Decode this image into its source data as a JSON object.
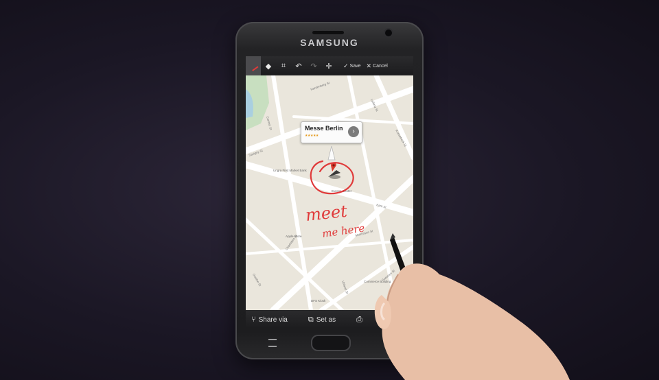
{
  "device": {
    "brand": "SAMSUNG"
  },
  "toolbar": {
    "tools": [
      {
        "name": "pen-icon",
        "active": true
      },
      {
        "name": "eraser-icon"
      },
      {
        "name": "crop-icon"
      },
      {
        "name": "undo-icon"
      },
      {
        "name": "redo-icon"
      },
      {
        "name": "move-icon"
      }
    ],
    "save_label": "Save",
    "cancel_label": "Cancel"
  },
  "map": {
    "callout_title": "Messe Berlin",
    "callout_rating": "★★★★★",
    "streets": [
      "Hardenberg St",
      "Leibniz St",
      "Carmer St",
      "Knesebeck St",
      "Savigny St",
      "Kant St",
      "Charlotten St",
      "Uhland St",
      "Fasanen St",
      "Goethe St",
      "Mommsen St"
    ],
    "places": [
      "Ungra First Market Bank",
      "Europa Center",
      "Apple Store",
      "Commerce Building",
      "DFS Kiosk"
    ],
    "annotation_line1": "meet",
    "annotation_line2": "me here"
  },
  "bottombar": {
    "share_label": "Share via",
    "setas_label": "Set as"
  },
  "colors": {
    "accent": "#e03a3a",
    "map_bg": "#eae6dc",
    "road": "#ffffff",
    "park": "#c8dfc0"
  }
}
